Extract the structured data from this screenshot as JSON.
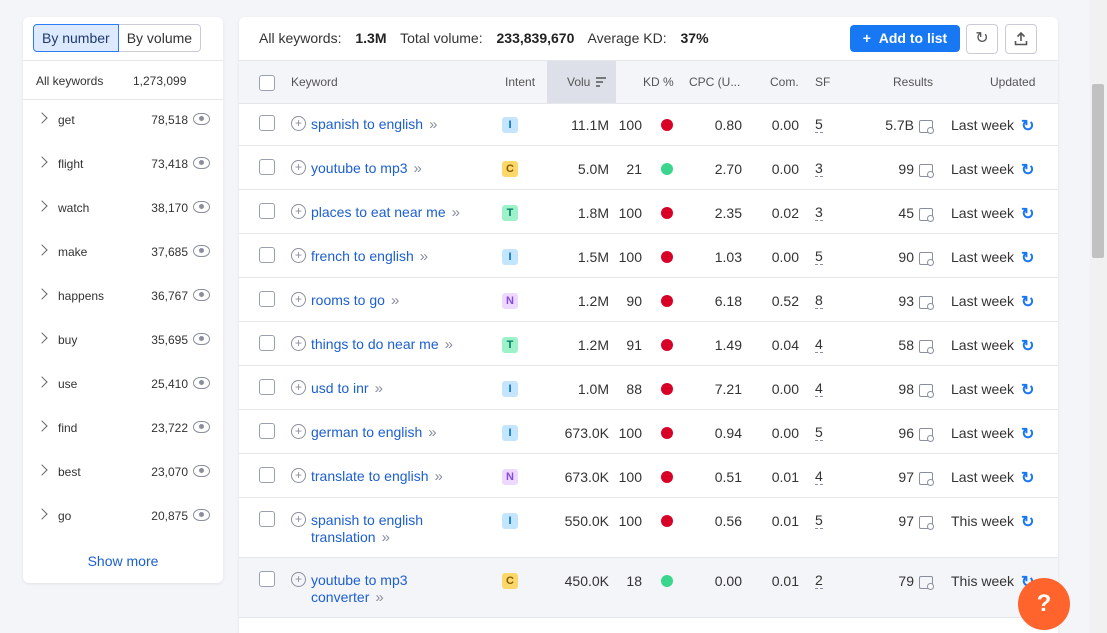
{
  "sidebar": {
    "tabs": [
      "By number",
      "By volume"
    ],
    "header": {
      "keyword": "All keywords",
      "count": "1,273,099"
    },
    "items": [
      {
        "label": "get",
        "count": "78,518"
      },
      {
        "label": "flight",
        "count": "73,418"
      },
      {
        "label": "watch",
        "count": "38,170"
      },
      {
        "label": "make",
        "count": "37,685"
      },
      {
        "label": "happens",
        "count": "36,767"
      },
      {
        "label": "buy",
        "count": "35,695"
      },
      {
        "label": "use",
        "count": "25,410"
      },
      {
        "label": "find",
        "count": "23,722"
      },
      {
        "label": "best",
        "count": "23,070"
      },
      {
        "label": "go",
        "count": "20,875"
      }
    ],
    "show_more": "Show more"
  },
  "summary": {
    "all_label": "All keywords:",
    "all_value": "1.3M",
    "vol_label": "Total volume:",
    "vol_value": "233,839,670",
    "kd_label": "Average KD:",
    "kd_value": "37%"
  },
  "toolbar": {
    "add_label": "Add to list",
    "add_icon": "+"
  },
  "columns": {
    "keyword": "Keyword",
    "intent": "Intent",
    "volume": "Volu",
    "kd": "KD %",
    "cpc": "CPC (U...",
    "com": "Com.",
    "sf": "SF",
    "results": "Results",
    "updated": "Updated"
  },
  "colors": {
    "accent": "#1877f2",
    "kd_red": "#d80027",
    "kd_green": "#3bd68e",
    "intent_I_bg": "#c4e5fe",
    "intent_I_fg": "#006dca",
    "intent_C_bg": "#fcd86b",
    "intent_C_fg": "#8a5800",
    "intent_T_bg": "#9ef2c9",
    "intent_T_fg": "#007c65",
    "intent_N_bg": "#edd9ff",
    "intent_N_fg": "#8649e1"
  },
  "rows": [
    {
      "kw1": "spanish to english",
      "kw2": "",
      "intent": "I",
      "vol": "11.1M",
      "kd": "100",
      "kdc": "red",
      "cpc": "0.80",
      "com": "0.00",
      "sf": "5",
      "res": "5.7B",
      "upd": "Last week"
    },
    {
      "kw1": "youtube to mp3",
      "kw2": "",
      "intent": "C",
      "vol": "5.0M",
      "kd": "21",
      "kdc": "green",
      "cpc": "2.70",
      "com": "0.00",
      "sf": "3",
      "res": "99",
      "upd": "Last week"
    },
    {
      "kw1": "places to eat near me",
      "kw2": "",
      "intent": "T",
      "vol": "1.8M",
      "kd": "100",
      "kdc": "red",
      "cpc": "2.35",
      "com": "0.02",
      "sf": "3",
      "res": "45",
      "upd": "Last week"
    },
    {
      "kw1": "french to english",
      "kw2": "",
      "intent": "I",
      "vol": "1.5M",
      "kd": "100",
      "kdc": "red",
      "cpc": "1.03",
      "com": "0.00",
      "sf": "5",
      "res": "90",
      "upd": "Last week"
    },
    {
      "kw1": "rooms to go",
      "kw2": "",
      "intent": "N",
      "vol": "1.2M",
      "kd": "90",
      "kdc": "red",
      "cpc": "6.18",
      "com": "0.52",
      "sf": "8",
      "res": "93",
      "upd": "Last week"
    },
    {
      "kw1": "things to do near me",
      "kw2": "",
      "intent": "T",
      "vol": "1.2M",
      "kd": "91",
      "kdc": "red",
      "cpc": "1.49",
      "com": "0.04",
      "sf": "4",
      "res": "58",
      "upd": "Last week"
    },
    {
      "kw1": "usd to inr",
      "kw2": "",
      "intent": "I",
      "vol": "1.0M",
      "kd": "88",
      "kdc": "red",
      "cpc": "7.21",
      "com": "0.00",
      "sf": "4",
      "res": "98",
      "upd": "Last week"
    },
    {
      "kw1": "german to english",
      "kw2": "",
      "intent": "I",
      "vol": "673.0K",
      "kd": "100",
      "kdc": "red",
      "cpc": "0.94",
      "com": "0.00",
      "sf": "5",
      "res": "96",
      "upd": "Last week"
    },
    {
      "kw1": "translate to english",
      "kw2": "",
      "intent": "N",
      "vol": "673.0K",
      "kd": "100",
      "kdc": "red",
      "cpc": "0.51",
      "com": "0.01",
      "sf": "4",
      "res": "97",
      "upd": "Last week"
    },
    {
      "kw1": "spanish to english",
      "kw2": "translation",
      "intent": "I",
      "vol": "550.0K",
      "kd": "100",
      "kdc": "red",
      "cpc": "0.56",
      "com": "0.01",
      "sf": "5",
      "res": "97",
      "upd": "This week"
    },
    {
      "kw1": "youtube to mp3",
      "kw2": "converter",
      "intent": "C",
      "vol": "450.0K",
      "kd": "18",
      "kdc": "green",
      "cpc": "0.00",
      "com": "0.01",
      "sf": "2",
      "res": "79",
      "upd": "This week"
    }
  ],
  "help": "?"
}
